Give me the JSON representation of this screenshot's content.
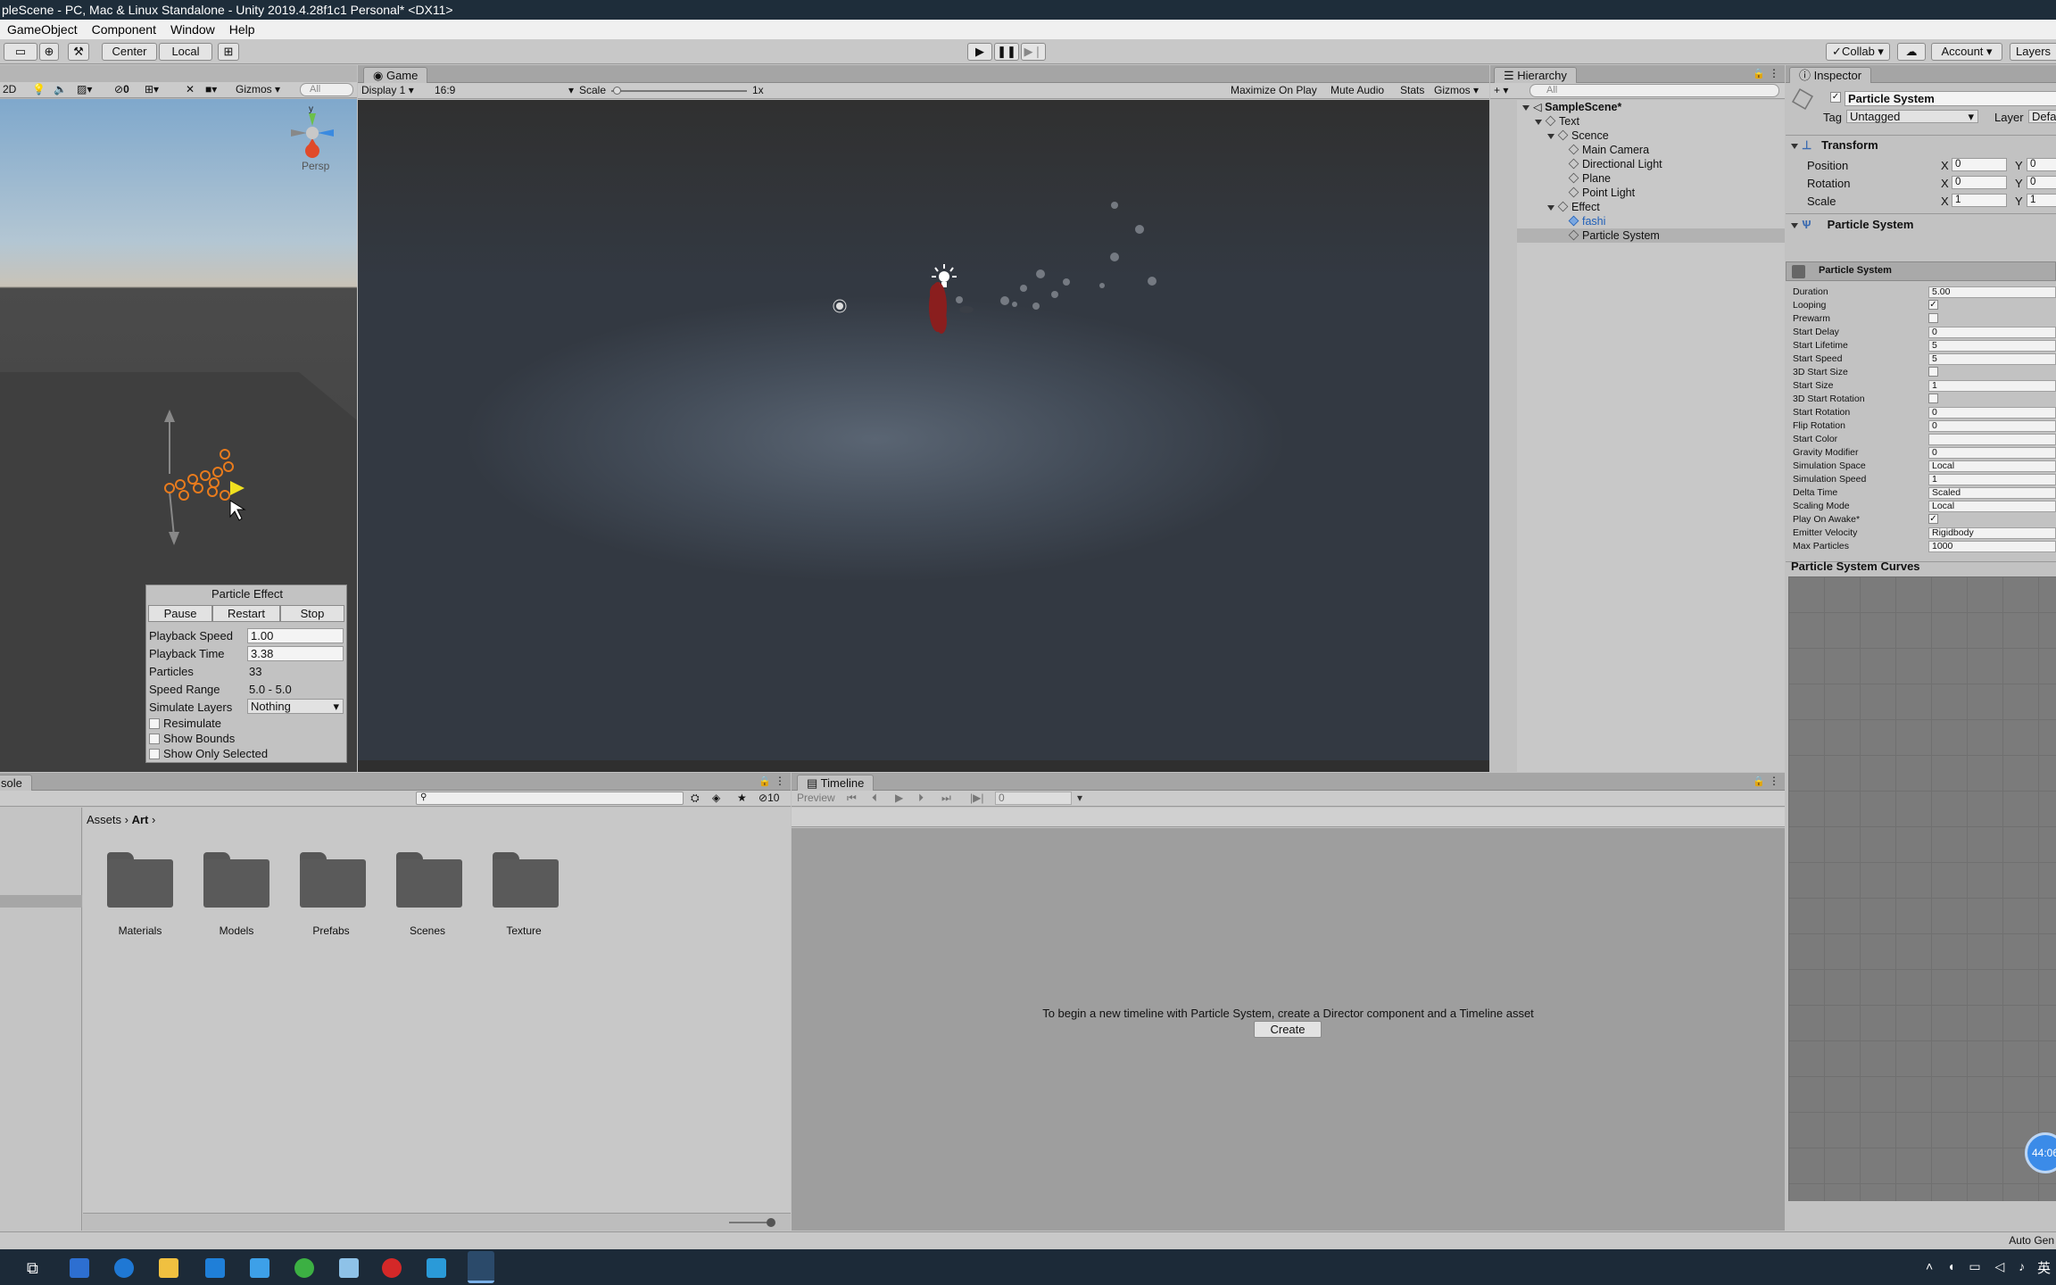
{
  "window": {
    "title": "pleScene - PC, Mac & Linux Standalone - Unity 2019.4.28f1c1 Personal* <DX11>"
  },
  "menu": [
    "GameObject",
    "Component",
    "Window",
    "Help"
  ],
  "toolbar": {
    "pivot": "Center",
    "space": "Local",
    "collab": "Collab",
    "account": "Account",
    "layers": "Layers"
  },
  "scene": {
    "mode_2d": "2D",
    "hidden_count": "0",
    "gizmos": "Gizmos",
    "search_placeholder": "All",
    "persp": "Persp",
    "axis_y": "y"
  },
  "game": {
    "tab": "Game",
    "display": "Display 1",
    "aspect": "16:9",
    "scale_label": "Scale",
    "scale_value": "1x",
    "maximize": "Maximize On Play",
    "mute": "Mute Audio",
    "stats": "Stats",
    "gizmos": "Gizmos"
  },
  "particle_effect": {
    "title": "Particle Effect",
    "pause": "Pause",
    "restart": "Restart",
    "stop": "Stop",
    "playback_speed_label": "Playback Speed",
    "playback_speed": "1.00",
    "playback_time_label": "Playback Time",
    "playback_time": "3.38",
    "particles_label": "Particles",
    "particles": "33",
    "speed_range_label": "Speed Range",
    "speed_range": "5.0 - 5.0",
    "simulate_layers_label": "Simulate Layers",
    "simulate_layers": "Nothing",
    "resimulate": "Resimulate",
    "show_bounds": "Show Bounds",
    "show_only_selected": "Show Only Selected"
  },
  "hierarchy": {
    "tab": "Hierarchy",
    "search_placeholder": "All",
    "items": [
      {
        "label": "SampleScene*",
        "depth": 0
      },
      {
        "label": "Text",
        "depth": 1
      },
      {
        "label": "Scence",
        "depth": 2
      },
      {
        "label": "Main Camera",
        "depth": 3
      },
      {
        "label": "Directional Light",
        "depth": 3
      },
      {
        "label": "Plane",
        "depth": 3
      },
      {
        "label": "Point Light",
        "depth": 3
      },
      {
        "label": "Effect",
        "depth": 2
      },
      {
        "label": "fashi",
        "depth": 3
      },
      {
        "label": "Particle System",
        "depth": 3
      }
    ]
  },
  "inspector": {
    "tab": "Inspector",
    "object_name": "Particle System",
    "tag_label": "Tag",
    "tag": "Untagged",
    "layer_label": "Layer",
    "layer": "Defa",
    "transform": {
      "title": "Transform",
      "position": "Position",
      "rotation": "Rotation",
      "scale": "Scale",
      "pos_x": "0",
      "pos_y": "0",
      "rot_x": "0",
      "rot_y": "0",
      "scl_x": "1",
      "scl_y": "1",
      "x": "X",
      "y": "Y"
    },
    "ps_component": "Particle System",
    "ps_module": "Particle System",
    "fields": [
      {
        "label": "Duration",
        "value": "5.00"
      },
      {
        "label": "Looping",
        "check": "✓"
      },
      {
        "label": "Prewarm",
        "check": ""
      },
      {
        "label": "Start Delay",
        "value": "0"
      },
      {
        "label": "Start Lifetime",
        "value": "5"
      },
      {
        "label": "Start Speed",
        "value": "5"
      },
      {
        "label": "3D Start Size",
        "check": ""
      },
      {
        "label": "Start Size",
        "value": "1"
      },
      {
        "label": "3D Start Rotation",
        "check": ""
      },
      {
        "label": "Start Rotation",
        "value": "0"
      },
      {
        "label": "Flip Rotation",
        "value": "0"
      },
      {
        "label": "Start Color",
        "value": ""
      },
      {
        "label": "Gravity Modifier",
        "value": "0"
      },
      {
        "label": "Simulation Space",
        "value": "Local"
      },
      {
        "label": "Simulation Speed",
        "value": "1"
      },
      {
        "label": "Delta Time",
        "value": "Scaled"
      },
      {
        "label": "Scaling Mode",
        "value": "Local"
      },
      {
        "label": "Play On Awake*",
        "check": "✓"
      },
      {
        "label": "Emitter Velocity",
        "value": "Rigidbody"
      },
      {
        "label": "Max Particles",
        "value": "1000"
      }
    ],
    "curves_title": "Particle System Curves",
    "timer": "44:06"
  },
  "project": {
    "tab": "sole",
    "breadcrumb_root": "Assets",
    "breadcrumb_current": "Art",
    "hidden_count": "10",
    "folders": [
      "Materials",
      "Models",
      "Prefabs",
      "Scenes",
      "Texture"
    ]
  },
  "timeline": {
    "tab": "Timeline",
    "preview": "Preview",
    "frame": "0",
    "message": "To begin a new timeline with Particle System, create a Director component and a Timeline asset",
    "create": "Create"
  },
  "status": {
    "right": "Auto Gen"
  }
}
